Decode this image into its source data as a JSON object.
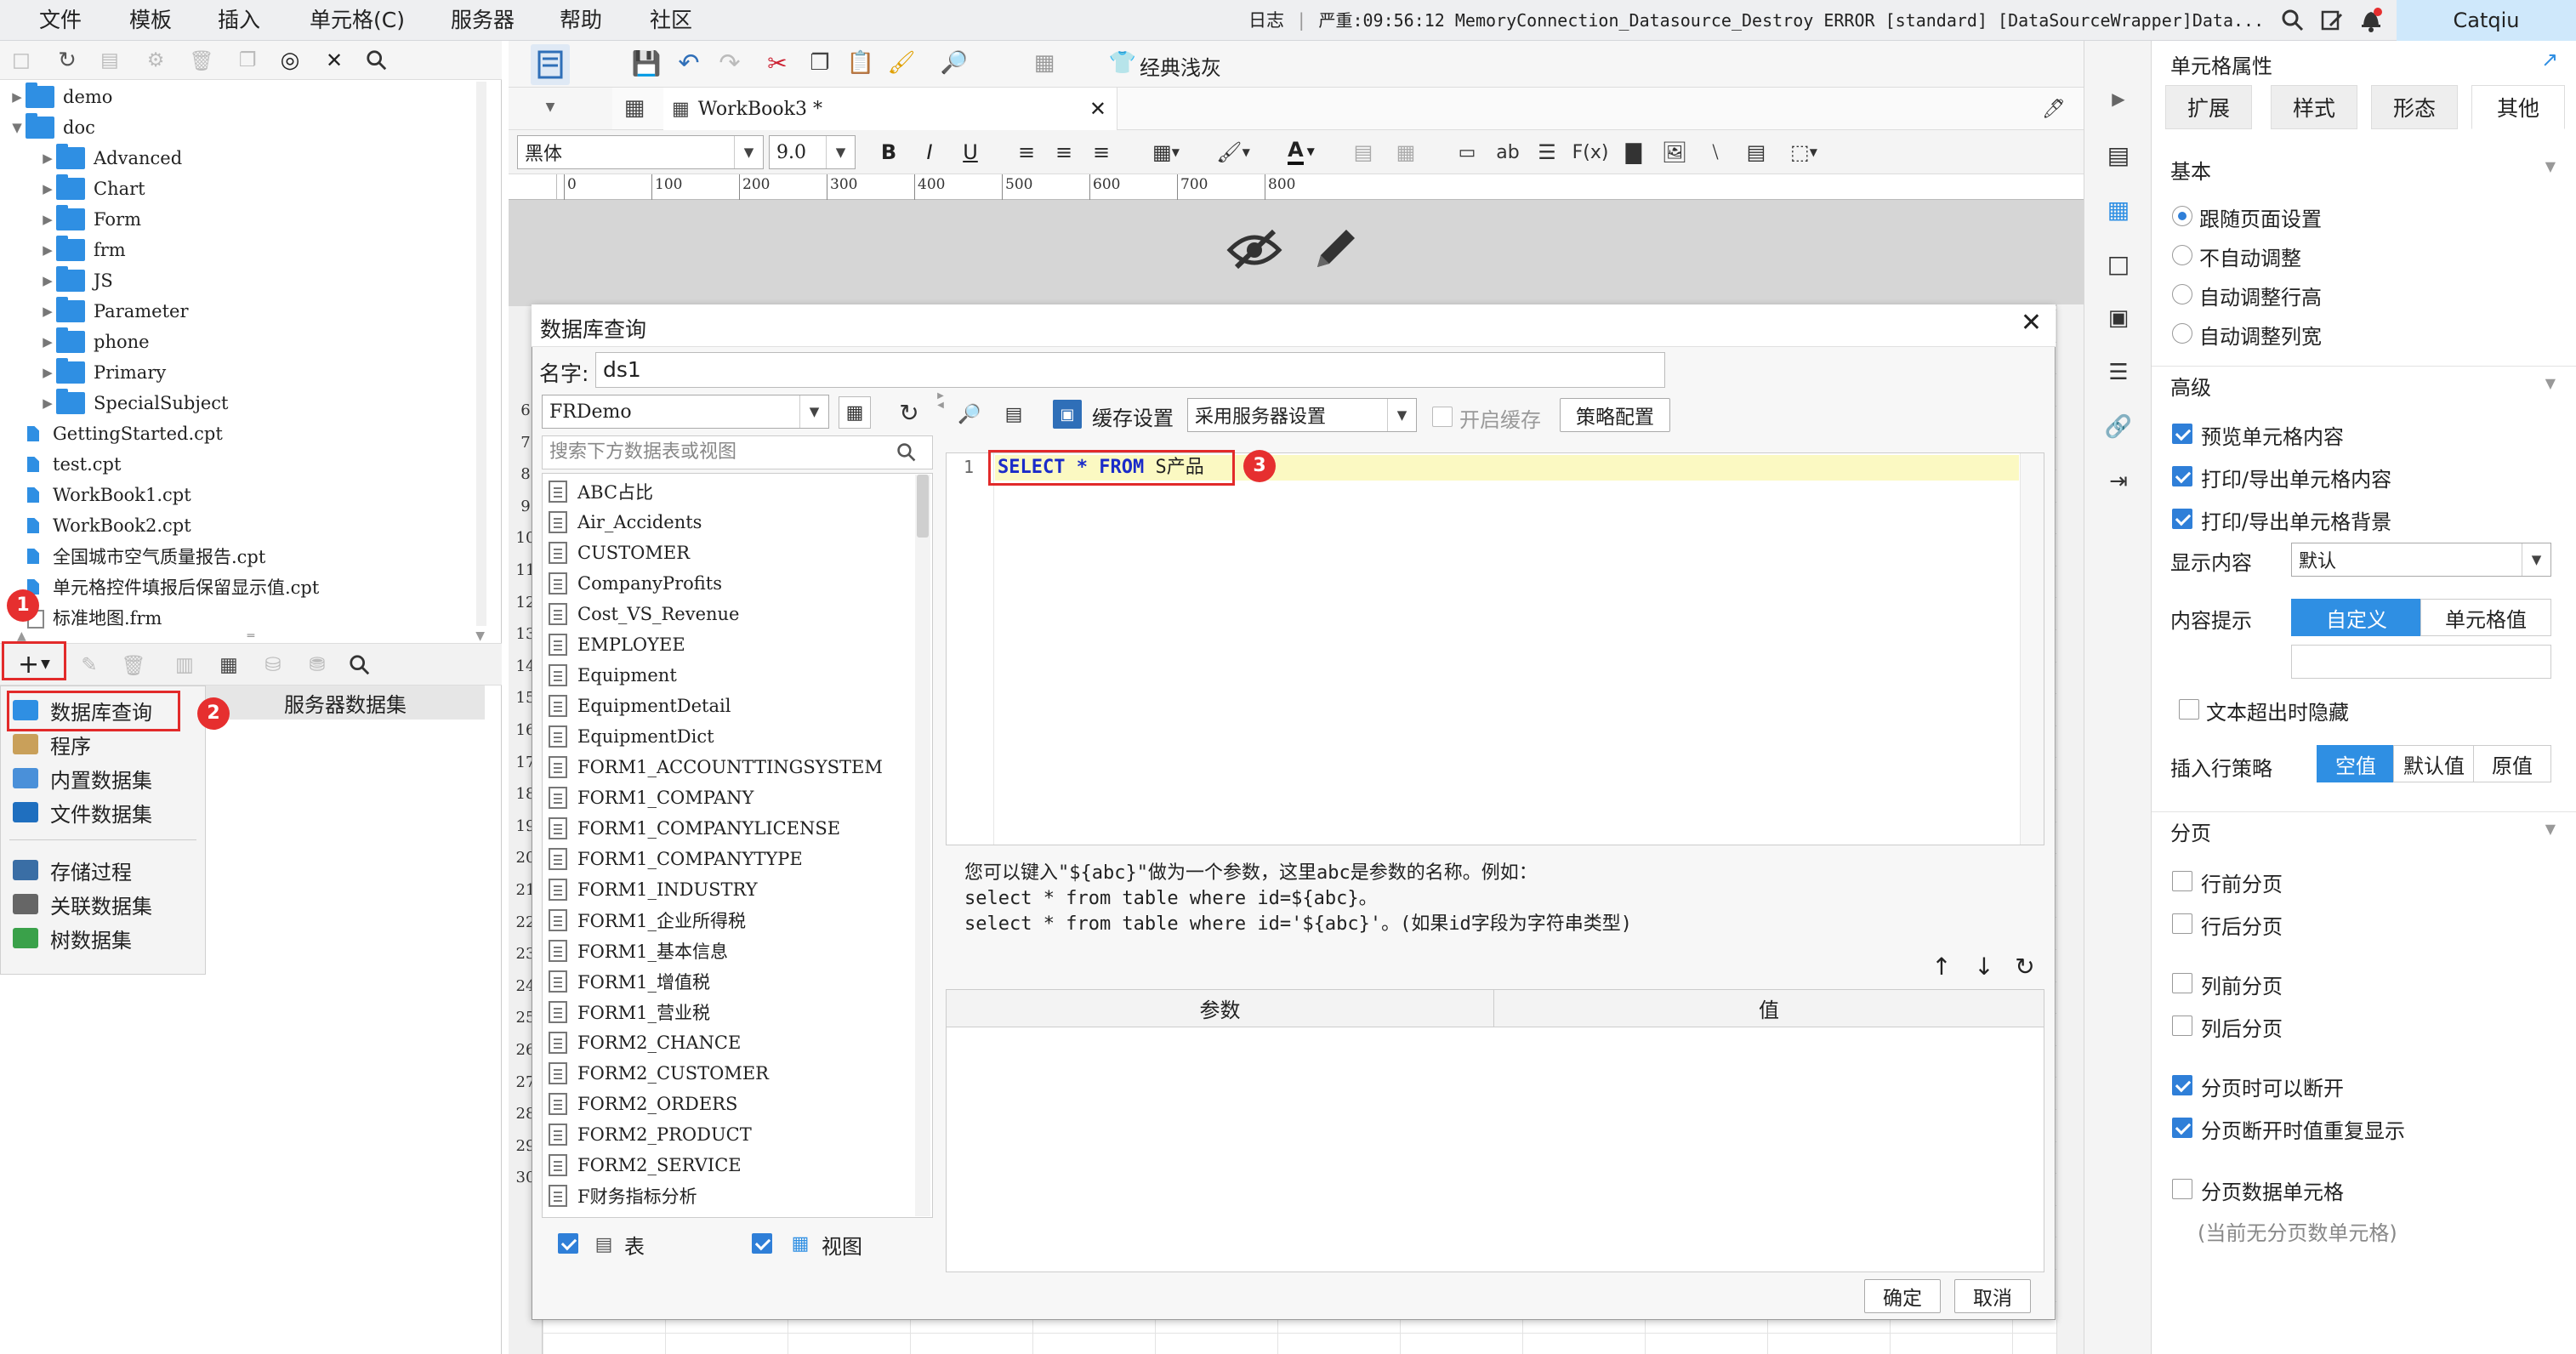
{
  "menu": {
    "items": [
      "文件",
      "模板",
      "插入",
      "单元格(C)",
      "服务器",
      "帮助",
      "社区"
    ],
    "log_label": "日志",
    "log_message": "严重:09:56:12 MemoryConnection_Datasource_Destroy ERROR [standard] [DataSourceWrapper]Data...",
    "user": "Catqiu"
  },
  "file_tree": {
    "items": [
      {
        "label": "demo",
        "type": "folder",
        "level": 0
      },
      {
        "label": "doc",
        "type": "folder",
        "level": 0
      },
      {
        "label": "Advanced",
        "type": "folder",
        "level": 1
      },
      {
        "label": "Chart",
        "type": "folder",
        "level": 1
      },
      {
        "label": "Form",
        "type": "folder",
        "level": 1
      },
      {
        "label": "frm",
        "type": "folder",
        "level": 1
      },
      {
        "label": "JS",
        "type": "folder",
        "level": 1
      },
      {
        "label": "Parameter",
        "type": "folder",
        "level": 1
      },
      {
        "label": "phone",
        "type": "folder",
        "level": 1
      },
      {
        "label": "Primary",
        "type": "folder",
        "level": 1
      },
      {
        "label": "SpecialSubject",
        "type": "folder",
        "level": 1
      },
      {
        "label": "GettingStarted.cpt",
        "type": "cpt",
        "level": 0
      },
      {
        "label": "test.cpt",
        "type": "cpt",
        "level": 0
      },
      {
        "label": "WorkBook1.cpt",
        "type": "cpt",
        "level": 0
      },
      {
        "label": "WorkBook2.cpt",
        "type": "cpt",
        "level": 0
      },
      {
        "label": "全国城市空气质量报告.cpt",
        "type": "cpt",
        "level": 0
      },
      {
        "label": "单元格控件填报后保留显示值.cpt",
        "type": "cpt",
        "level": 0
      },
      {
        "label": "标准地图.frm",
        "type": "frm",
        "level": 0
      }
    ]
  },
  "dataset_panel": {
    "server_dataset_label": "服务器数据集",
    "menu_items": [
      {
        "label": "数据库查询",
        "color": "#2f8fe3"
      },
      {
        "label": "程序",
        "color": "#c9a05a"
      },
      {
        "label": "内置数据集",
        "color": "#4a90d9"
      },
      {
        "label": "文件数据集",
        "color": "#1f6fbf"
      },
      {
        "label": "存储过程",
        "color": "#3a6ea5"
      },
      {
        "label": "关联数据集",
        "color": "#666666"
      },
      {
        "label": "树数据集",
        "color": "#3aa14a"
      }
    ]
  },
  "badges": {
    "b1": "1",
    "b2": "2",
    "b3": "3"
  },
  "toolbar": {
    "classic_gray_label": "经典浅灰"
  },
  "tab": {
    "workbook_label": "WorkBook3 *"
  },
  "format": {
    "font_name": "黑体",
    "font_size": "9.0"
  },
  "ruler_ticks": [
    "0",
    "100",
    "200",
    "300",
    "400",
    "500",
    "600",
    "700",
    "800"
  ],
  "row_numbers": [
    "6",
    "7",
    "8",
    "9",
    "10",
    "11",
    "12",
    "13",
    "14",
    "15",
    "16",
    "17",
    "18",
    "19",
    "20",
    "21",
    "22",
    "23",
    "24",
    "25",
    "26",
    "27",
    "28",
    "29",
    "30"
  ],
  "dialog": {
    "title": "数据库查询",
    "name_label": "名字:",
    "name_value": "ds1",
    "datasource": "FRDemo",
    "search_placeholder": "搜索下方数据表或视图",
    "cache_label": "缓存设置",
    "cache_select": "采用服务器设置",
    "enable_cache": "开启缓存",
    "strategy_button": "策略配置",
    "tables": [
      "ABC占比",
      "Air_Accidents",
      "CUSTOMER",
      "CompanyProfits",
      "Cost_VS_Revenue",
      "EMPLOYEE",
      "Equipment",
      "EquipmentDetail",
      "EquipmentDict",
      "FORM1_ACCOUNTTINGSYSTEM",
      "FORM1_COMPANY",
      "FORM1_COMPANYLICENSE",
      "FORM1_COMPANYTYPE",
      "FORM1_INDUSTRY",
      "FORM1_企业所得税",
      "FORM1_基本信息",
      "FORM1_增值税",
      "FORM1_营业税",
      "FORM2_CHANCE",
      "FORM2_CUSTOMER",
      "FORM2_ORDERS",
      "FORM2_PRODUCT",
      "FORM2_SERVICE",
      "F财务指标分析"
    ],
    "table_checkbox": "表",
    "view_checkbox": "视图",
    "line_number": "1",
    "sql_keyword_select": "SELECT",
    "sql_star": "*",
    "sql_keyword_from": "FROM",
    "sql_table": "S产品",
    "hint_lines": [
      "您可以键入\"${abc}\"做为一个参数，这里abc是参数的名称。例如：",
      "select * from table where id=${abc}。",
      "select * from table where id='${abc}'。(如果id字段为字符串类型)"
    ],
    "param_header": "参数",
    "value_header": "值",
    "ok_button": "确定",
    "cancel_button": "取消"
  },
  "right_panel": {
    "title": "单元格属性",
    "tabs": [
      "扩展",
      "样式",
      "形态",
      "其他"
    ],
    "basic_section": "基本",
    "radio_options": [
      "跟随页面设置",
      "不自动调整",
      "自动调整行高",
      "自动调整列宽"
    ],
    "advanced_section": "高级",
    "advanced_checks": [
      "预览单元格内容",
      "打印/导出单元格内容",
      "打印/导出单元格背景"
    ],
    "display_label": "显示内容",
    "display_value": "默认",
    "tip_label": "内容提示",
    "tip_options": [
      "自定义",
      "单元格值"
    ],
    "overflow_hide": "文本超出时隐藏",
    "insert_label": "插入行策略",
    "insert_options": [
      "空值",
      "默认值",
      "原值"
    ],
    "page_section": "分页",
    "page_checks": [
      {
        "label": "行前分页",
        "checked": false
      },
      {
        "label": "行后分页",
        "checked": false
      },
      {
        "label": "列前分页",
        "checked": false
      },
      {
        "label": "列后分页",
        "checked": false
      },
      {
        "label": "分页时可以断开",
        "checked": true
      },
      {
        "label": "分页断开时值重复显示",
        "checked": true
      },
      {
        "label": "分页数据单元格",
        "checked": false
      }
    ],
    "page_note": "(当前无分页数单元格)"
  },
  "colors": {
    "accent": "#2f8fe3",
    "highlight": "#e62f2f",
    "sql_keyword": "#1a2bc9",
    "sql_line_bg": "#fbf9c2"
  }
}
